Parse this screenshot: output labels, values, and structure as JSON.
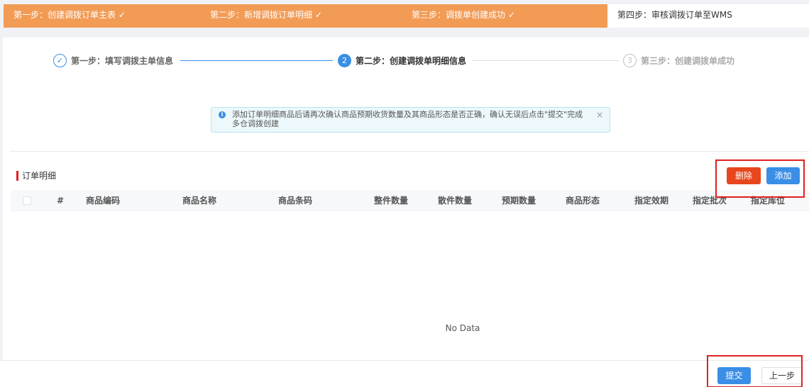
{
  "top_steps": [
    {
      "label": "第一步：创建调拨订单主表 ✓"
    },
    {
      "label": "第二步：新增调拨订单明细 ✓"
    },
    {
      "label": "第三步：调拨单创建成功 ✓"
    },
    {
      "label": "第四步：审核调拨订单至WMS"
    }
  ],
  "steps": [
    {
      "icon": "✓",
      "label": "第一步：填写调拨主单信息"
    },
    {
      "icon": "2",
      "label": "第二步：创建调拨单明细信息"
    },
    {
      "icon": "3",
      "label": "第三步：创建调拨单成功"
    }
  ],
  "alert": {
    "icon": "i",
    "message": "添加订单明细商品后请再次确认商品预期收货数量及其商品形态是否正确，确认无误后点击\"提交\"完成多仓调拨创建",
    "close": "×"
  },
  "section": {
    "title": "订单明细"
  },
  "buttons": {
    "delete": "删除",
    "add": "添加",
    "submit": "提交",
    "prev": "上一步"
  },
  "table": {
    "columns": [
      "#",
      "商品编码",
      "商品名称",
      "商品条码",
      "整件数量",
      "散件数量",
      "预期数量",
      "商品形态",
      "指定效期",
      "指定批次",
      "指定库位"
    ],
    "empty_text": "No Data"
  },
  "colors": {
    "accent": "#3a8ee6",
    "top_done": "#f29b55",
    "danger": "#e8461c",
    "highlight": "#e02020"
  }
}
